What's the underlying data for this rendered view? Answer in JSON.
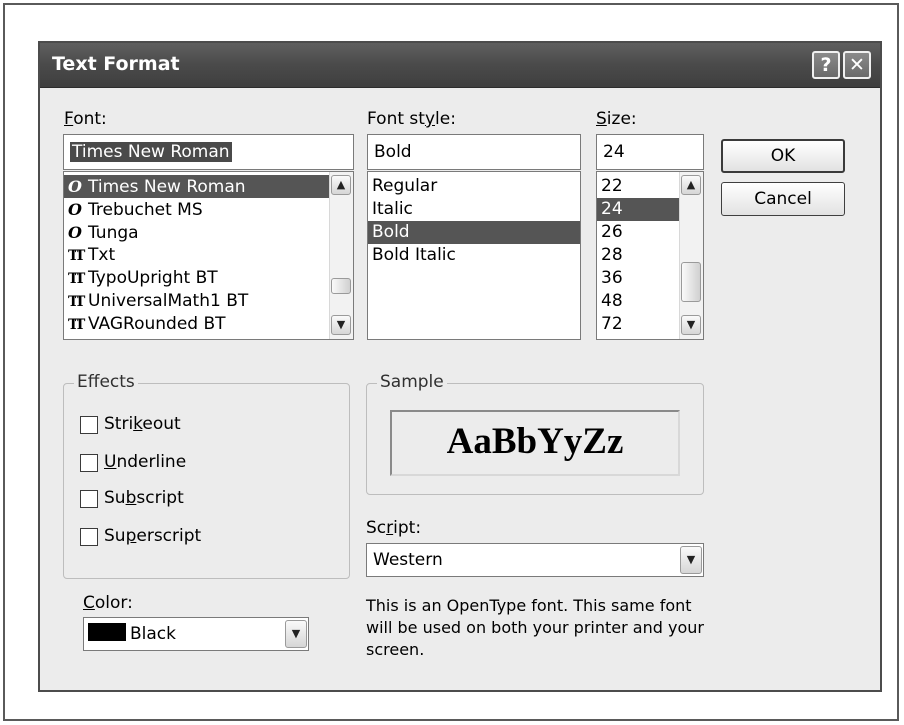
{
  "dialog": {
    "title": "Text Format",
    "help_glyph": "?",
    "close_glyph": "✕"
  },
  "font": {
    "label_accel": "F",
    "label_rest": "ont:",
    "value": "Times New Roman",
    "items": [
      {
        "icon": "opentype-icon",
        "glyph": "O",
        "name": "Times New Roman",
        "selected": true
      },
      {
        "icon": "opentype-icon",
        "glyph": "O",
        "name": "Trebuchet MS",
        "selected": false
      },
      {
        "icon": "opentype-icon",
        "glyph": "O",
        "name": "Tunga",
        "selected": false
      },
      {
        "icon": "truetype-icon",
        "glyph": "TT",
        "name": "Txt",
        "selected": false
      },
      {
        "icon": "truetype-icon",
        "glyph": "TT",
        "name": "TypoUpright BT",
        "selected": false
      },
      {
        "icon": "truetype-icon",
        "glyph": "TT",
        "name": "UniversalMath1 BT",
        "selected": false
      },
      {
        "icon": "truetype-icon",
        "glyph": "TT",
        "name": "VAGRounded BT",
        "selected": false
      }
    ]
  },
  "font_style": {
    "label_pre": "Font st",
    "label_accel": "y",
    "label_post": "le:",
    "value": "Bold",
    "items": [
      {
        "name": "Regular",
        "selected": false
      },
      {
        "name": "Italic",
        "selected": false
      },
      {
        "name": "Bold",
        "selected": true
      },
      {
        "name": "Bold Italic",
        "selected": false
      }
    ]
  },
  "size": {
    "label_accel": "S",
    "label_rest": "ize:",
    "value": "24",
    "items": [
      {
        "name": "22",
        "selected": false
      },
      {
        "name": "24",
        "selected": true
      },
      {
        "name": "26",
        "selected": false
      },
      {
        "name": "28",
        "selected": false
      },
      {
        "name": "36",
        "selected": false
      },
      {
        "name": "48",
        "selected": false
      },
      {
        "name": "72",
        "selected": false
      }
    ]
  },
  "buttons": {
    "ok": "OK",
    "cancel": "Cancel"
  },
  "effects": {
    "title": "Effects",
    "strikeout": {
      "pre": "Stri",
      "accel": "k",
      "post": "eout",
      "checked": false
    },
    "underline": {
      "pre": "",
      "accel": "U",
      "post": "nderline",
      "checked": false
    },
    "subscript": {
      "pre": "Su",
      "accel": "b",
      "post": "script",
      "checked": false
    },
    "superscript": {
      "pre": "Su",
      "accel": "p",
      "post": "erscript",
      "checked": false
    }
  },
  "sample": {
    "title": "Sample",
    "text": "AaBbYyZz"
  },
  "script": {
    "label_pre": "Sc",
    "label_accel": "r",
    "label_post": "ipt:",
    "value": "Western"
  },
  "color": {
    "label_accel": "C",
    "label_rest": "olor:",
    "value": "Black",
    "swatch": "#000000"
  },
  "description": "This is an OpenType font. This same font will be used on both your printer and your screen."
}
